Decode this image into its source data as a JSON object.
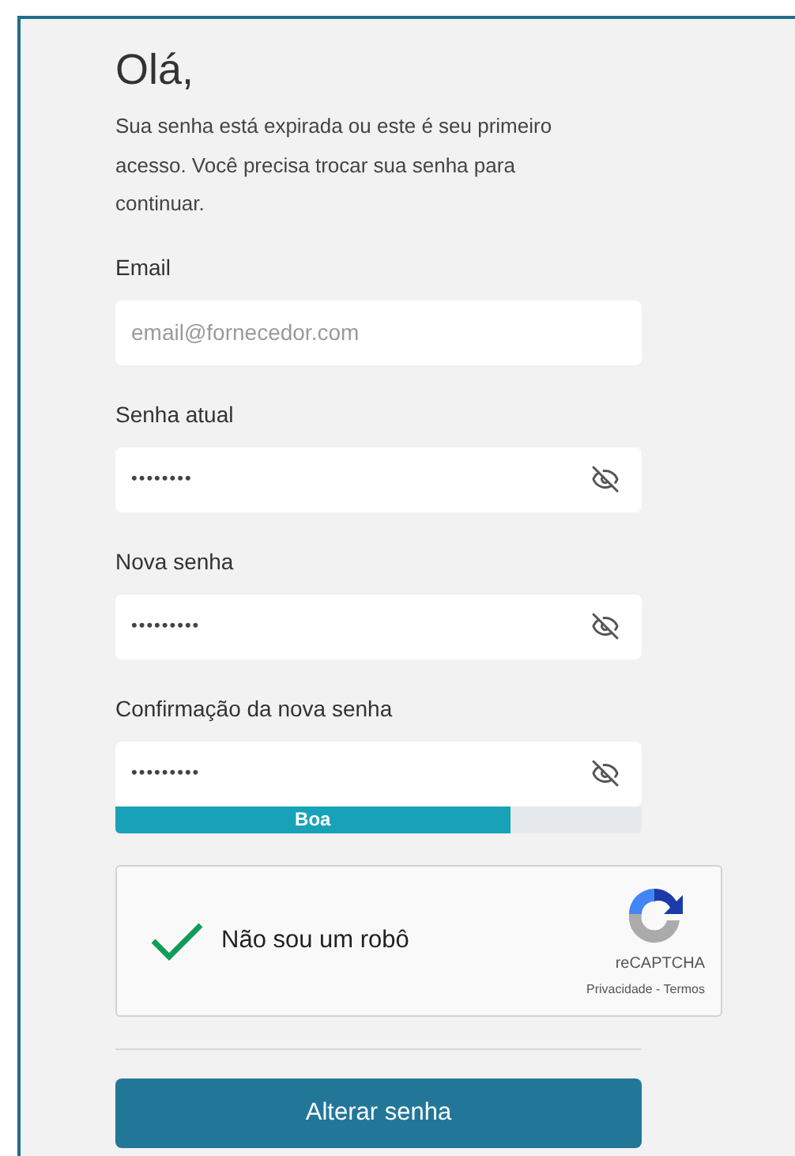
{
  "heading": "Olá,",
  "intro": "Sua senha está expirada ou este é seu primeiro acesso. Você precisa trocar sua senha para continuar.",
  "fields": [
    {
      "kind": "text",
      "label": "Email",
      "placeholder": "email@fornecedor.com"
    },
    {
      "kind": "password",
      "label": "Senha atual",
      "value": "••••••••"
    },
    {
      "kind": "password",
      "label": "Nova senha",
      "value": "•••••••••"
    },
    {
      "kind": "password",
      "label": "Confirmação da nova senha",
      "value": "•••••••••"
    }
  ],
  "strength": {
    "label": "Boa",
    "level": 0.75
  },
  "captcha": {
    "label": "Não sou um robô",
    "checked": true,
    "brand": "reCAPTCHA",
    "links": "Privacidade - Termos"
  },
  "submit": "Alterar senha"
}
